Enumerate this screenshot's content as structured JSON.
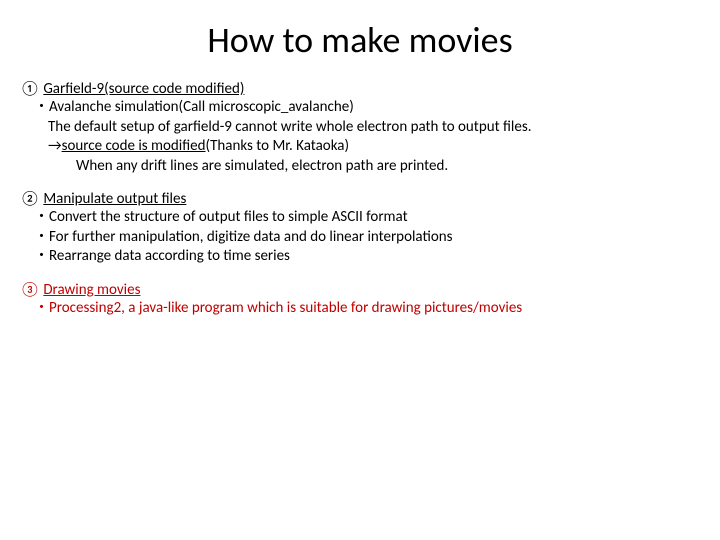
{
  "title": "How to make movies",
  "sections": [
    {
      "num": "①",
      "head": "Garfield-9(source code modified)",
      "lines": [
        {
          "cls": "indent1",
          "text": "・Avalanche simulation(Call microscopic_avalanche)"
        },
        {
          "cls": "indent2",
          "text": "The default setup of garfield-9 cannot write whole electron path to output files."
        },
        {
          "cls": "indent2",
          "html": "→<span class=\"underline\">source code is modified</span>(Thanks to Mr. Kataoka)"
        },
        {
          "cls": "indent4",
          "text": "When any drift lines are simulated, electron path are printed."
        }
      ],
      "red": false
    },
    {
      "num": "②",
      "head": "Manipulate output files",
      "lines": [
        {
          "cls": "indent1",
          "text": "・Convert the structure of output files to simple ASCII format"
        },
        {
          "cls": "indent1",
          "text": "・For further manipulation, digitize data and do linear interpolations"
        },
        {
          "cls": "indent1",
          "text": "・Rearrange data according to time series"
        }
      ],
      "red": false
    },
    {
      "num": "③",
      "head": "Drawing movies",
      "lines": [
        {
          "cls": "indent1",
          "text": "・Processing2, a java-like program which is suitable for drawing pictures/movies"
        }
      ],
      "red": true
    }
  ]
}
